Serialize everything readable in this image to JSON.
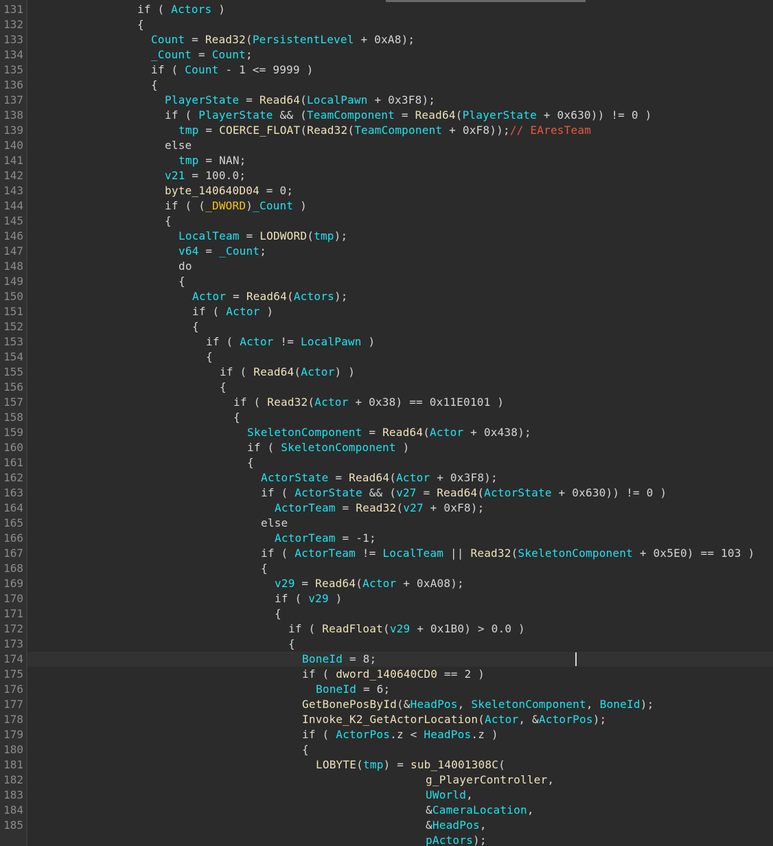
{
  "colors": {
    "background": "#2b2b2b",
    "gutter": "#313131",
    "line_number": "#8c8c8c",
    "plain": "#d6d6d6",
    "variable": "#1ee4f2",
    "function": "#f0e4b8",
    "comment": "#e85a3a",
    "macro": "#f5c518"
  },
  "editor": {
    "current_line": 174,
    "lines": [
      {
        "n": "131",
        "indent": 16,
        "tokens": [
          [
            "k",
            "if ( "
          ],
          [
            "v",
            "Actors"
          ],
          [
            "t",
            " )"
          ]
        ]
      },
      {
        "n": "132",
        "indent": 16,
        "tokens": [
          [
            "t",
            "{"
          ]
        ]
      },
      {
        "n": "133",
        "indent": 18,
        "tokens": [
          [
            "v",
            "Count"
          ],
          [
            "t",
            " = "
          ],
          [
            "f",
            "Read32"
          ],
          [
            "t",
            "("
          ],
          [
            "v",
            "PersistentLevel"
          ],
          [
            "t",
            " + 0xA8);"
          ]
        ]
      },
      {
        "n": "134",
        "indent": 18,
        "tokens": [
          [
            "v",
            "_Count"
          ],
          [
            "t",
            " = "
          ],
          [
            "v",
            "Count"
          ],
          [
            "t",
            ";"
          ]
        ]
      },
      {
        "n": "135",
        "indent": 18,
        "tokens": [
          [
            "k",
            "if ( "
          ],
          [
            "v",
            "Count"
          ],
          [
            "t",
            " - 1 <= 9999 )"
          ]
        ]
      },
      {
        "n": "136",
        "indent": 18,
        "tokens": [
          [
            "t",
            "{"
          ]
        ]
      },
      {
        "n": "137",
        "indent": 20,
        "tokens": [
          [
            "v",
            "PlayerState"
          ],
          [
            "t",
            " = "
          ],
          [
            "f",
            "Read64"
          ],
          [
            "t",
            "("
          ],
          [
            "v",
            "LocalPawn"
          ],
          [
            "t",
            " + 0x3F8);"
          ]
        ]
      },
      {
        "n": "138",
        "indent": 20,
        "tokens": [
          [
            "k",
            "if ( "
          ],
          [
            "v",
            "PlayerState"
          ],
          [
            "t",
            " && ("
          ],
          [
            "v",
            "TeamComponent"
          ],
          [
            "t",
            " = "
          ],
          [
            "f",
            "Read64"
          ],
          [
            "t",
            "("
          ],
          [
            "v",
            "PlayerState"
          ],
          [
            "t",
            " + 0x630)) != 0 )"
          ]
        ]
      },
      {
        "n": "139",
        "indent": 22,
        "tokens": [
          [
            "v",
            "tmp"
          ],
          [
            "t",
            " = "
          ],
          [
            "f",
            "COERCE_FLOAT"
          ],
          [
            "t",
            "("
          ],
          [
            "f",
            "Read32"
          ],
          [
            "t",
            "("
          ],
          [
            "v",
            "TeamComponent"
          ],
          [
            "t",
            " + 0xF8));"
          ],
          [
            "c",
            "// EAresTeam"
          ]
        ]
      },
      {
        "n": "140",
        "indent": 20,
        "tokens": [
          [
            "k",
            "else"
          ]
        ]
      },
      {
        "n": "141",
        "indent": 22,
        "tokens": [
          [
            "v",
            "tmp"
          ],
          [
            "t",
            " = NAN;"
          ]
        ]
      },
      {
        "n": "142",
        "indent": 20,
        "tokens": [
          [
            "v",
            "v21"
          ],
          [
            "t",
            " = 100.0;"
          ]
        ]
      },
      {
        "n": "143",
        "indent": 20,
        "tokens": [
          [
            "f",
            "byte_140640D04"
          ],
          [
            "t",
            " = 0;"
          ]
        ]
      },
      {
        "n": "144",
        "indent": 20,
        "tokens": [
          [
            "k",
            "if ( ("
          ],
          [
            "y",
            "_DWORD"
          ],
          [
            "t",
            ")"
          ],
          [
            "v",
            "_Count"
          ],
          [
            "t",
            " )"
          ]
        ]
      },
      {
        "n": "145",
        "indent": 20,
        "tokens": [
          [
            "t",
            "{"
          ]
        ]
      },
      {
        "n": "146",
        "indent": 22,
        "tokens": [
          [
            "v",
            "LocalTeam"
          ],
          [
            "t",
            " = "
          ],
          [
            "f",
            "LODWORD"
          ],
          [
            "t",
            "("
          ],
          [
            "v",
            "tmp"
          ],
          [
            "t",
            ");"
          ]
        ]
      },
      {
        "n": "147",
        "indent": 22,
        "tokens": [
          [
            "v",
            "v64"
          ],
          [
            "t",
            " = "
          ],
          [
            "v",
            "_Count"
          ],
          [
            "t",
            ";"
          ]
        ]
      },
      {
        "n": "148",
        "indent": 22,
        "tokens": [
          [
            "k",
            "do"
          ]
        ]
      },
      {
        "n": "149",
        "indent": 22,
        "tokens": [
          [
            "t",
            "{"
          ]
        ]
      },
      {
        "n": "150",
        "indent": 24,
        "tokens": [
          [
            "v",
            "Actor"
          ],
          [
            "t",
            " = "
          ],
          [
            "f",
            "Read64"
          ],
          [
            "t",
            "("
          ],
          [
            "v",
            "Actors"
          ],
          [
            "t",
            ");"
          ]
        ]
      },
      {
        "n": "151",
        "indent": 24,
        "tokens": [
          [
            "k",
            "if ( "
          ],
          [
            "v",
            "Actor"
          ],
          [
            "t",
            " )"
          ]
        ]
      },
      {
        "n": "152",
        "indent": 24,
        "tokens": [
          [
            "t",
            "{"
          ]
        ]
      },
      {
        "n": "153",
        "indent": 26,
        "tokens": [
          [
            "k",
            "if ( "
          ],
          [
            "v",
            "Actor"
          ],
          [
            "t",
            " != "
          ],
          [
            "v",
            "LocalPawn"
          ],
          [
            "t",
            " )"
          ]
        ]
      },
      {
        "n": "154",
        "indent": 26,
        "tokens": [
          [
            "t",
            "{"
          ]
        ]
      },
      {
        "n": "155",
        "indent": 28,
        "tokens": [
          [
            "k",
            "if ( "
          ],
          [
            "f",
            "Read64"
          ],
          [
            "t",
            "("
          ],
          [
            "v",
            "Actor"
          ],
          [
            "t",
            ") )"
          ]
        ]
      },
      {
        "n": "156",
        "indent": 28,
        "tokens": [
          [
            "t",
            "{"
          ]
        ]
      },
      {
        "n": "157",
        "indent": 30,
        "tokens": [
          [
            "k",
            "if ( "
          ],
          [
            "f",
            "Read32"
          ],
          [
            "t",
            "("
          ],
          [
            "v",
            "Actor"
          ],
          [
            "t",
            " + 0x38) == 0x11E0101 )"
          ]
        ]
      },
      {
        "n": "158",
        "indent": 30,
        "tokens": [
          [
            "t",
            "{"
          ]
        ]
      },
      {
        "n": "159",
        "indent": 32,
        "tokens": [
          [
            "v",
            "SkeletonComponent"
          ],
          [
            "t",
            " = "
          ],
          [
            "f",
            "Read64"
          ],
          [
            "t",
            "("
          ],
          [
            "v",
            "Actor"
          ],
          [
            "t",
            " + 0x438);"
          ]
        ]
      },
      {
        "n": "160",
        "indent": 32,
        "tokens": [
          [
            "k",
            "if ( "
          ],
          [
            "v",
            "SkeletonComponent"
          ],
          [
            "t",
            " )"
          ]
        ]
      },
      {
        "n": "161",
        "indent": 32,
        "tokens": [
          [
            "t",
            "{"
          ]
        ]
      },
      {
        "n": "162",
        "indent": 34,
        "tokens": [
          [
            "v",
            "ActorState"
          ],
          [
            "t",
            " = "
          ],
          [
            "f",
            "Read64"
          ],
          [
            "t",
            "("
          ],
          [
            "v",
            "Actor"
          ],
          [
            "t",
            " + 0x3F8);"
          ]
        ]
      },
      {
        "n": "163",
        "indent": 34,
        "tokens": [
          [
            "k",
            "if ( "
          ],
          [
            "v",
            "ActorState"
          ],
          [
            "t",
            " && ("
          ],
          [
            "v",
            "v27"
          ],
          [
            "t",
            " = "
          ],
          [
            "f",
            "Read64"
          ],
          [
            "t",
            "("
          ],
          [
            "v",
            "ActorState"
          ],
          [
            "t",
            " + 0x630)) != 0 )"
          ]
        ]
      },
      {
        "n": "164",
        "indent": 36,
        "tokens": [
          [
            "v",
            "ActorTeam"
          ],
          [
            "t",
            " = "
          ],
          [
            "f",
            "Read32"
          ],
          [
            "t",
            "("
          ],
          [
            "v",
            "v27"
          ],
          [
            "t",
            " + 0xF8);"
          ]
        ]
      },
      {
        "n": "165",
        "indent": 34,
        "tokens": [
          [
            "k",
            "else"
          ]
        ]
      },
      {
        "n": "166",
        "indent": 36,
        "tokens": [
          [
            "v",
            "ActorTeam"
          ],
          [
            "t",
            " = -1;"
          ]
        ]
      },
      {
        "n": "167",
        "indent": 34,
        "tokens": [
          [
            "k",
            "if ( "
          ],
          [
            "v",
            "ActorTeam"
          ],
          [
            "t",
            " != "
          ],
          [
            "v",
            "LocalTeam"
          ],
          [
            "t",
            " || "
          ],
          [
            "f",
            "Read32"
          ],
          [
            "t",
            "("
          ],
          [
            "v",
            "SkeletonComponent"
          ],
          [
            "t",
            " + 0x5E0) == 103 )"
          ]
        ]
      },
      {
        "n": "168",
        "indent": 34,
        "tokens": [
          [
            "t",
            "{"
          ]
        ]
      },
      {
        "n": "169",
        "indent": 36,
        "tokens": [
          [
            "v",
            "v29"
          ],
          [
            "t",
            " = "
          ],
          [
            "f",
            "Read64"
          ],
          [
            "t",
            "("
          ],
          [
            "v",
            "Actor"
          ],
          [
            "t",
            " + 0xA08);"
          ]
        ]
      },
      {
        "n": "170",
        "indent": 36,
        "tokens": [
          [
            "k",
            "if ( "
          ],
          [
            "v",
            "v29"
          ],
          [
            "t",
            " )"
          ]
        ]
      },
      {
        "n": "171",
        "indent": 36,
        "tokens": [
          [
            "t",
            "{"
          ]
        ]
      },
      {
        "n": "172",
        "indent": 38,
        "tokens": [
          [
            "k",
            "if ( "
          ],
          [
            "f",
            "ReadFloat"
          ],
          [
            "t",
            "("
          ],
          [
            "v",
            "v29"
          ],
          [
            "t",
            " + 0x1B0) > 0.0 )"
          ]
        ]
      },
      {
        "n": "173",
        "indent": 38,
        "tokens": [
          [
            "t",
            "{"
          ]
        ]
      },
      {
        "n": "174",
        "indent": 40,
        "tokens": [
          [
            "v",
            "BoneId"
          ],
          [
            "t",
            " = 8;"
          ]
        ]
      },
      {
        "n": "175",
        "indent": 40,
        "tokens": [
          [
            "k",
            "if ( "
          ],
          [
            "f",
            "dword_140640CD0"
          ],
          [
            "t",
            " == 2 )"
          ]
        ]
      },
      {
        "n": "176",
        "indent": 42,
        "tokens": [
          [
            "v",
            "BoneId"
          ],
          [
            "t",
            " = 6;"
          ]
        ]
      },
      {
        "n": "177",
        "indent": 40,
        "tokens": [
          [
            "f",
            "GetBonePosById"
          ],
          [
            "t",
            "(&"
          ],
          [
            "v",
            "HeadPos"
          ],
          [
            "t",
            ", "
          ],
          [
            "v",
            "SkeletonComponent"
          ],
          [
            "t",
            ", "
          ],
          [
            "v",
            "BoneId"
          ],
          [
            "t",
            ");"
          ]
        ]
      },
      {
        "n": "178",
        "indent": 40,
        "tokens": [
          [
            "f",
            "Invoke_K2_GetActorLocation"
          ],
          [
            "t",
            "("
          ],
          [
            "v",
            "Actor"
          ],
          [
            "t",
            ", &"
          ],
          [
            "v",
            "ActorPos"
          ],
          [
            "t",
            ");"
          ]
        ]
      },
      {
        "n": "179",
        "indent": 40,
        "tokens": [
          [
            "k",
            "if ( "
          ],
          [
            "v",
            "ActorPos"
          ],
          [
            "t",
            ".z < "
          ],
          [
            "v",
            "HeadPos"
          ],
          [
            "t",
            ".z )"
          ]
        ]
      },
      {
        "n": "180",
        "indent": 40,
        "tokens": [
          [
            "t",
            "{"
          ]
        ]
      },
      {
        "n": "181",
        "indent": 42,
        "tokens": [
          [
            "f",
            "LOBYTE"
          ],
          [
            "t",
            "("
          ],
          [
            "v",
            "tmp"
          ],
          [
            "t",
            ") = "
          ],
          [
            "f",
            "sub_14001308C"
          ],
          [
            "t",
            "("
          ]
        ]
      },
      {
        "n": "182",
        "indent": 58,
        "tokens": [
          [
            "f",
            "g_PlayerController"
          ],
          [
            "t",
            ","
          ]
        ]
      },
      {
        "n": "183",
        "indent": 58,
        "tokens": [
          [
            "v",
            "UWorld"
          ],
          [
            "t",
            ","
          ]
        ]
      },
      {
        "n": "184",
        "indent": 58,
        "tokens": [
          [
            "t",
            "&"
          ],
          [
            "v",
            "CameraLocation"
          ],
          [
            "t",
            ","
          ]
        ]
      },
      {
        "n": "185",
        "indent": 58,
        "tokens": [
          [
            "t",
            "&"
          ],
          [
            "v",
            "HeadPos"
          ],
          [
            "t",
            ","
          ]
        ]
      },
      {
        "n": "",
        "indent": 58,
        "tokens": [
          [
            "v",
            "pActors"
          ],
          [
            "t",
            ");"
          ]
        ]
      }
    ]
  }
}
